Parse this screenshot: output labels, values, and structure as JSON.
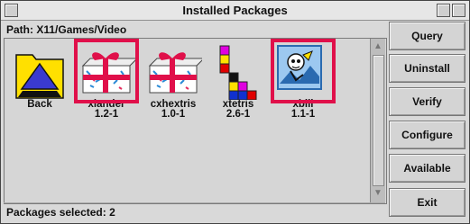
{
  "window": {
    "title": "Installed Packages"
  },
  "path": {
    "label": "Path: X11/Games/Video"
  },
  "packages": [
    {
      "name": "Back",
      "version": "",
      "icon": "folder-up-icon",
      "selected": false
    },
    {
      "name": "xlander",
      "version": "1.2-1",
      "icon": "package-gift-icon",
      "selected": true
    },
    {
      "name": "cxhextris",
      "version": "1.0-1",
      "icon": "package-gift-icon",
      "selected": false
    },
    {
      "name": "xtetris",
      "version": "2.6-1",
      "icon": "tetris-blocks-icon",
      "selected": false
    },
    {
      "name": "xbill",
      "version": "1.1-1",
      "icon": "xbill-icon",
      "selected": true
    }
  ],
  "buttons": {
    "query": "Query",
    "uninstall": "Uninstall",
    "verify": "Verify",
    "configure": "Configure",
    "available": "Available",
    "exit": "Exit"
  },
  "status": {
    "text": "Packages selected: 2"
  },
  "colors": {
    "selection": "#e0104a",
    "folder": "#ffe000",
    "arrow": "#3a3ad0"
  }
}
